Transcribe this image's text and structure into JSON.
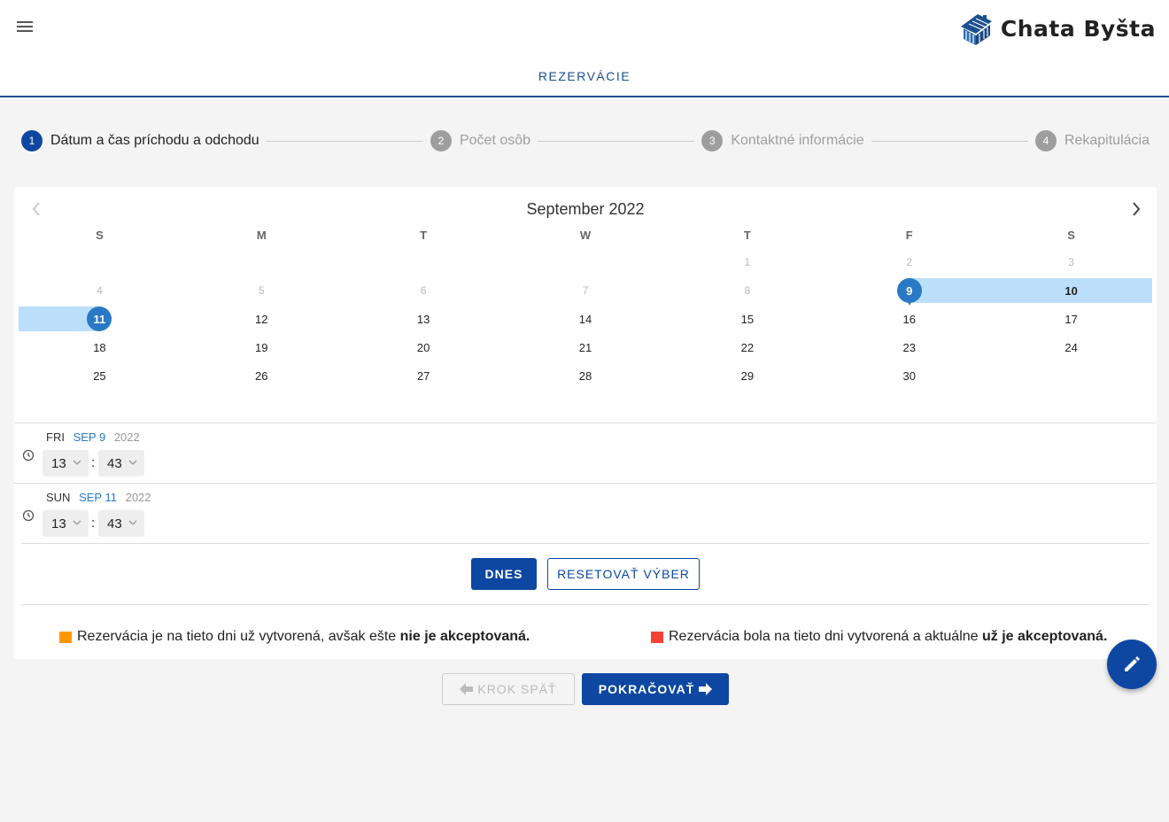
{
  "header": {
    "title": "REZERVÁCIE",
    "logo_text": "Chata Byšta"
  },
  "stepper": [
    {
      "num": "1",
      "label": "Dátum a čas príchodu a odchodu"
    },
    {
      "num": "2",
      "label": "Počet osôb"
    },
    {
      "num": "3",
      "label": "Kontaktné informácie"
    },
    {
      "num": "4",
      "label": "Rekapitulácia"
    }
  ],
  "calendar": {
    "month_label": "September 2022",
    "weekdays": [
      "S",
      "M",
      "T",
      "W",
      "T",
      "F",
      "S"
    ],
    "rows": [
      [
        "",
        "",
        "",
        "",
        "1",
        "2",
        "3"
      ],
      [
        "4",
        "5",
        "6",
        "7",
        "8",
        "9",
        "10"
      ],
      [
        "11",
        "12",
        "13",
        "14",
        "15",
        "16",
        "17"
      ],
      [
        "18",
        "19",
        "20",
        "21",
        "22",
        "23",
        "24"
      ],
      [
        "25",
        "26",
        "27",
        "28",
        "29",
        "30",
        ""
      ]
    ],
    "selected_start": "9",
    "selected_end": "11"
  },
  "times": [
    {
      "weekday": "FRI",
      "monthday": "SEP 9",
      "year": "2022",
      "hour": "13",
      "minute": "43"
    },
    {
      "weekday": "SUN",
      "monthday": "SEP 11",
      "year": "2022",
      "hour": "13",
      "minute": "43"
    }
  ],
  "time_separator": ":",
  "buttons": {
    "today": "DNES",
    "reset": "RESETOVAŤ VÝBER",
    "back": "KROK SPÄŤ",
    "next": "POKRAČOVAŤ"
  },
  "legend": {
    "pending_text": "Rezervácia je na tieto dni už vytvorená, avšak ešte ",
    "pending_bold": "nie je akceptovaná.",
    "pending_color": "#ff9800",
    "accepted_text": "Rezervácia bola na tieto dni vytvorená a aktuálne ",
    "accepted_bold": "už je akceptovaná.",
    "accepted_color": "#f44336"
  },
  "colors": {
    "primary": "#0d47a1",
    "selected_day": "#2979c6",
    "range": "#bbdefb"
  },
  "icons": {
    "menu": "hamburger-menu-icon",
    "logo": "cabin-logo-icon",
    "prev_month": "chevron-left-icon",
    "next_month": "chevron-right-icon",
    "clock": "clock-icon",
    "dropdown": "chevron-down-icon",
    "back_arrow": "arrow-left-icon",
    "next_arrow": "arrow-right-icon",
    "fab": "pencil-icon"
  }
}
